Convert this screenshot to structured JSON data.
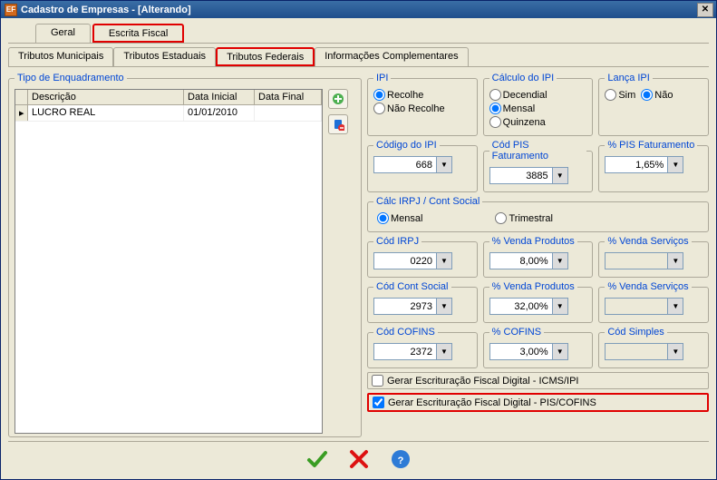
{
  "window": {
    "title": "Cadastro de Empresas - [Alterando]",
    "app_icon_label": "EF"
  },
  "main_tabs": {
    "geral": "Geral",
    "escrita_fiscal": "Escrita Fiscal"
  },
  "sub_tabs": {
    "municipais": "Tributos Municipais",
    "estaduais": "Tributos Estaduais",
    "federais": "Tributos Federais",
    "complementares": "Informações Complementares"
  },
  "enquadramento": {
    "legend": "Tipo de Enquadramento",
    "columns": {
      "descricao": "Descrição",
      "data_inicial": "Data Inicial",
      "data_final": "Data Final"
    },
    "rows": [
      {
        "descricao": "LUCRO REAL",
        "data_inicial": "01/01/2010",
        "data_final": ""
      }
    ]
  },
  "ipi": {
    "legend": "IPI",
    "recolhe": "Recolhe",
    "nao_recolhe": "Não Recolhe"
  },
  "calc_ipi": {
    "legend": "Cálculo do IPI",
    "decendial": "Decendial",
    "mensal": "Mensal",
    "quinzena": "Quinzena"
  },
  "lanca_ipi": {
    "legend": "Lança IPI",
    "sim": "Sim",
    "nao": "Não"
  },
  "codigo_ipi": {
    "legend": "Código do IPI",
    "value": "668"
  },
  "cod_pis_fat": {
    "legend": "Cód PIS Faturamento",
    "value": "3885"
  },
  "pct_pis_fat": {
    "legend": "% PIS Faturamento",
    "value": "1,65%"
  },
  "calc_irpj": {
    "legend": "Cálc IRPJ / Cont Social",
    "mensal": "Mensal",
    "trimestral": "Trimestral"
  },
  "cod_irpj": {
    "legend": "Cód IRPJ",
    "value": "0220"
  },
  "pct_venda_prod1": {
    "legend": "% Venda Produtos",
    "value": "8,00%"
  },
  "pct_venda_serv1": {
    "legend": "% Venda Serviços",
    "value": ""
  },
  "cod_cont_social": {
    "legend": "Cód Cont Social",
    "value": "2973"
  },
  "pct_venda_prod2": {
    "legend": "% Venda Produtos",
    "value": "32,00%"
  },
  "pct_venda_serv2": {
    "legend": "% Venda Serviços",
    "value": ""
  },
  "cod_cofins": {
    "legend": "Cód COFINS",
    "value": "2372"
  },
  "pct_cofins": {
    "legend": "% COFINS",
    "value": "3,00%"
  },
  "cod_simples": {
    "legend": "Cód Simples",
    "value": ""
  },
  "checkboxes": {
    "efd_icms": "Gerar Escrituração Fiscal Digital - ICMS/IPI",
    "efd_pis": "Gerar Escrituração Fiscal Digital - PIS/COFINS"
  }
}
